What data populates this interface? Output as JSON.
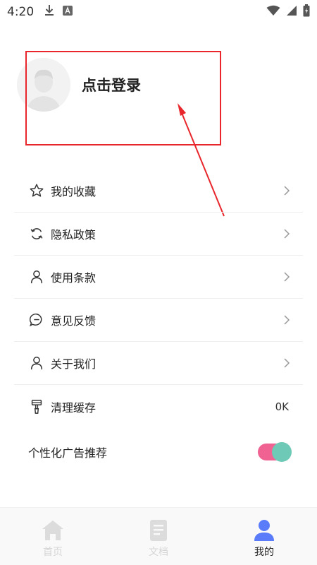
{
  "status_bar": {
    "time": "4:20"
  },
  "profile": {
    "login_label": "点击登录"
  },
  "menu": {
    "items": [
      {
        "label": "我的收藏",
        "icon": "star-icon"
      },
      {
        "label": "隐私政策",
        "icon": "refresh-icon"
      },
      {
        "label": "使用条款",
        "icon": "person-icon"
      },
      {
        "label": "意见反馈",
        "icon": "chat-bubble-icon"
      },
      {
        "label": "关于我们",
        "icon": "person-icon"
      },
      {
        "label": "清理缓存",
        "icon": "broom-icon",
        "value": "0K"
      }
    ],
    "ad_toggle": {
      "label": "个性化广告推荐",
      "on": true
    }
  },
  "tabs": [
    {
      "label": "首页",
      "icon": "home-icon",
      "active": false
    },
    {
      "label": "文档",
      "icon": "document-icon",
      "active": false
    },
    {
      "label": "我的",
      "icon": "user-icon",
      "active": true
    }
  ],
  "colors": {
    "accent": "#5b7cfa",
    "annotation": "#e8262b",
    "toggle_track": "#f06292",
    "toggle_knob": "#6ec9b6",
    "inactive_tab": "#d5d5d5"
  }
}
